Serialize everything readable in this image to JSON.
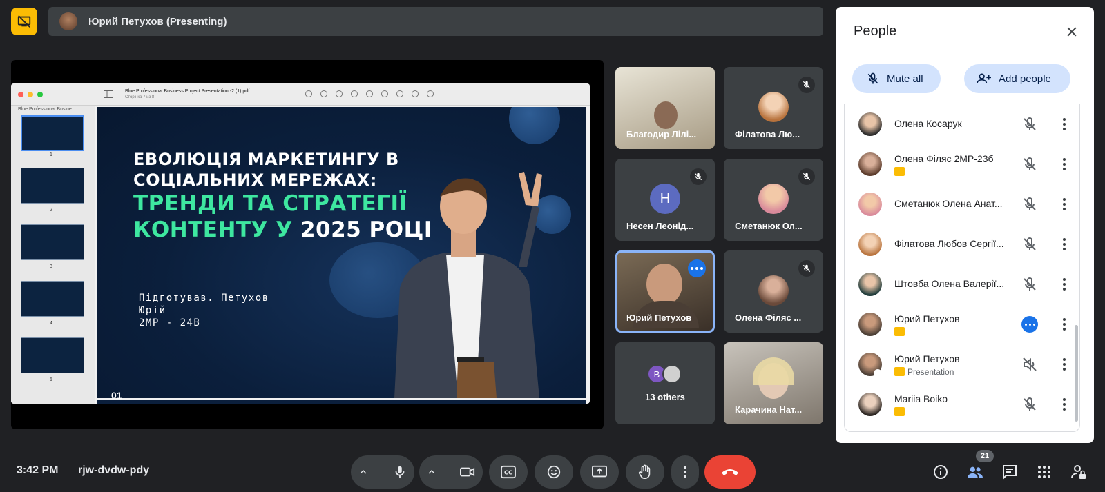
{
  "header": {
    "presenting_label": "Юрий Петухов (Presenting)"
  },
  "presentation": {
    "pdf_title": "Blue Professional Business Project Presentation -2 (1).pdf",
    "pdf_subtitle": "Сторінка 7 из 8",
    "sidebar_title": "Blue Professional Busine...",
    "thumbnails": [
      "1",
      "2",
      "3",
      "4",
      "5"
    ],
    "slide": {
      "line1": "ЕВОЛЮЦІЯ МАРКЕТИНГУ В",
      "line2": "СОЦІАЛЬНИХ МЕРЕЖАХ:",
      "line3": "ТРЕНДИ ТА СТРАТЕГІЇ",
      "line4_green": "КОНТЕНТУ У",
      "line4_white": "2025 РОЦІ",
      "prepared": "Підготував. Петухов",
      "name": "Юрій",
      "group": "2МР - 24В",
      "page_mark": "01"
    }
  },
  "tiles": [
    {
      "name": "Благодир Лілі..."
    },
    {
      "name": "Філатова Лю..."
    },
    {
      "name": "Несен Леонід...",
      "initial": "Н"
    },
    {
      "name": "Сметанюк Ол..."
    },
    {
      "name": "Юрий Петухов"
    },
    {
      "name": "Олена Філяс ..."
    },
    {
      "name": "13 others",
      "initial": "В"
    },
    {
      "name": "Карачина Нат..."
    }
  ],
  "people_panel": {
    "title": "People",
    "mute_all": "Mute all",
    "add_people": "Add people",
    "participants": [
      {
        "name": "Олена Косарук",
        "sub": ""
      },
      {
        "name": "Олена Філяс 2МР-23б",
        "sub": ""
      },
      {
        "name": "Сметанюк Олена Анат...",
        "sub": ""
      },
      {
        "name": "Філатова Любов Сергії...",
        "sub": ""
      },
      {
        "name": "Штовба Олена Валерії...",
        "sub": ""
      },
      {
        "name": "Юрий Петухов",
        "sub": ""
      },
      {
        "name": "Юрий Петухов",
        "sub": "Presentation"
      },
      {
        "name": "Mariia Boiko",
        "sub": ""
      }
    ]
  },
  "bottom_bar": {
    "time": "3:42 PM",
    "meeting_code": "rjw-dvdw-pdy",
    "participant_count": "21"
  },
  "colors": {
    "accent": "#8ab4f8",
    "end_call": "#ea4335",
    "badge": "#fbbc04",
    "green_text": "#3ee7a0"
  }
}
